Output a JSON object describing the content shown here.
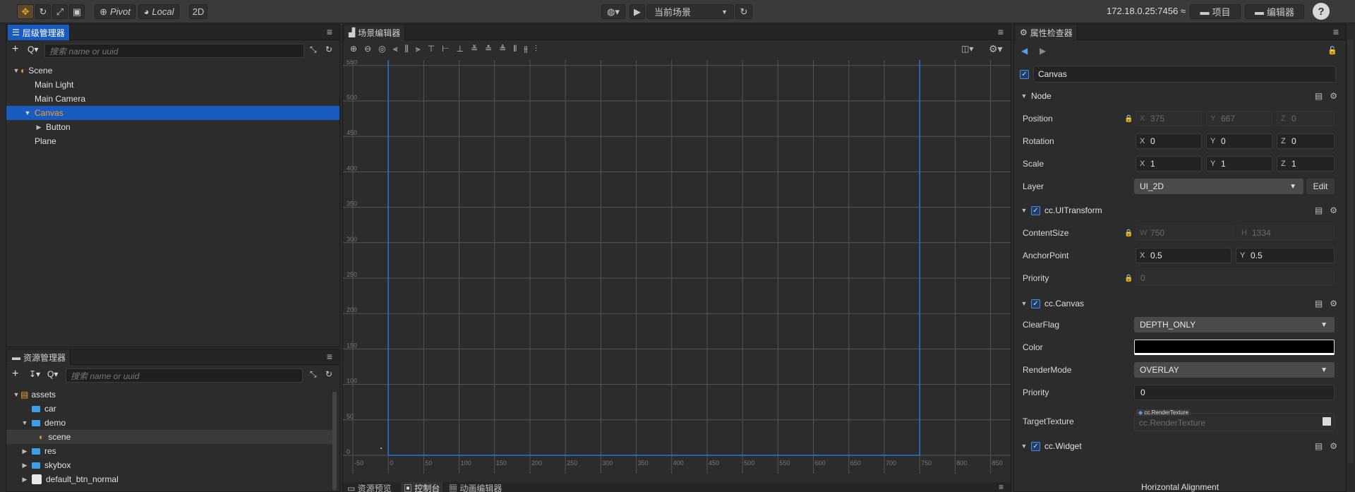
{
  "toolbar": {
    "pivot_label": "Pivot",
    "local_label": "Local",
    "mode_2d": "2D",
    "scene_select": "当前场景",
    "ip": "172.18.0.25:7456",
    "project_button": "项目",
    "editor_button": "编辑器"
  },
  "hierarchy": {
    "title": "层级管理器",
    "search_placeholder": "搜索 name or uuid",
    "items": [
      {
        "label": "Scene"
      },
      {
        "label": "Main Light"
      },
      {
        "label": "Main Camera"
      },
      {
        "label": "Canvas"
      },
      {
        "label": "Button"
      },
      {
        "label": "Plane"
      }
    ]
  },
  "assets": {
    "title": "资源管理器",
    "search_placeholder": "搜索 name or uuid",
    "items": [
      {
        "label": "assets"
      },
      {
        "label": "car"
      },
      {
        "label": "demo"
      },
      {
        "label": "scene"
      },
      {
        "label": "res"
      },
      {
        "label": "skybox"
      },
      {
        "label": "default_btn_normal"
      }
    ]
  },
  "scene": {
    "title": "场景编辑器",
    "y_ticks": [
      "550",
      "500",
      "450",
      "400",
      "350",
      "300",
      "250",
      "200",
      "150",
      "100",
      "50",
      "0"
    ],
    "x_ticks": [
      "-50",
      "0",
      "50",
      "100",
      "150",
      "200",
      "250",
      "300",
      "350",
      "400",
      "450",
      "500",
      "550",
      "600",
      "650",
      "700",
      "750",
      "800",
      "850"
    ],
    "bottom_tabs": [
      "资源预览",
      "控制台",
      "动画编辑器"
    ]
  },
  "inspector": {
    "title": "属性检查器",
    "node_name": "Canvas",
    "node_section": "Node",
    "position_label": "Position",
    "position": {
      "x": "375",
      "y": "667",
      "z": "0"
    },
    "rotation_label": "Rotation",
    "rotation": {
      "x": "0",
      "y": "0",
      "z": "0"
    },
    "scale_label": "Scale",
    "scale": {
      "x": "1",
      "y": "1",
      "z": "1"
    },
    "layer_label": "Layer",
    "layer_value": "UI_2D",
    "edit_button": "Edit",
    "uitransform_section": "cc.UITransform",
    "contentsize_label": "ContentSize",
    "contentsize": {
      "w": "750",
      "h": "1334"
    },
    "anchor_label": "AnchorPoint",
    "anchor": {
      "x": "0.5",
      "y": "0.5"
    },
    "priority_label": "Priority",
    "priority_value": "0",
    "canvas_section": "cc.Canvas",
    "clearflag_label": "ClearFlag",
    "clearflag_value": "DEPTH_ONLY",
    "color_label": "Color",
    "color_value": "#000000",
    "rendermode_label": "RenderMode",
    "rendermode_value": "OVERLAY",
    "priority2_label": "Priority",
    "priority2_value": "0",
    "targettexture_label": "TargetTexture",
    "targettexture_tag": "cc.RenderTexture",
    "targettexture_value": "cc.RenderTexture",
    "widget_section": "cc.Widget",
    "horizontal_alignment": "Horizontal Alignment"
  },
  "axis_labels": {
    "x": "X",
    "y": "Y",
    "z": "Z",
    "w": "W",
    "h": "H"
  }
}
